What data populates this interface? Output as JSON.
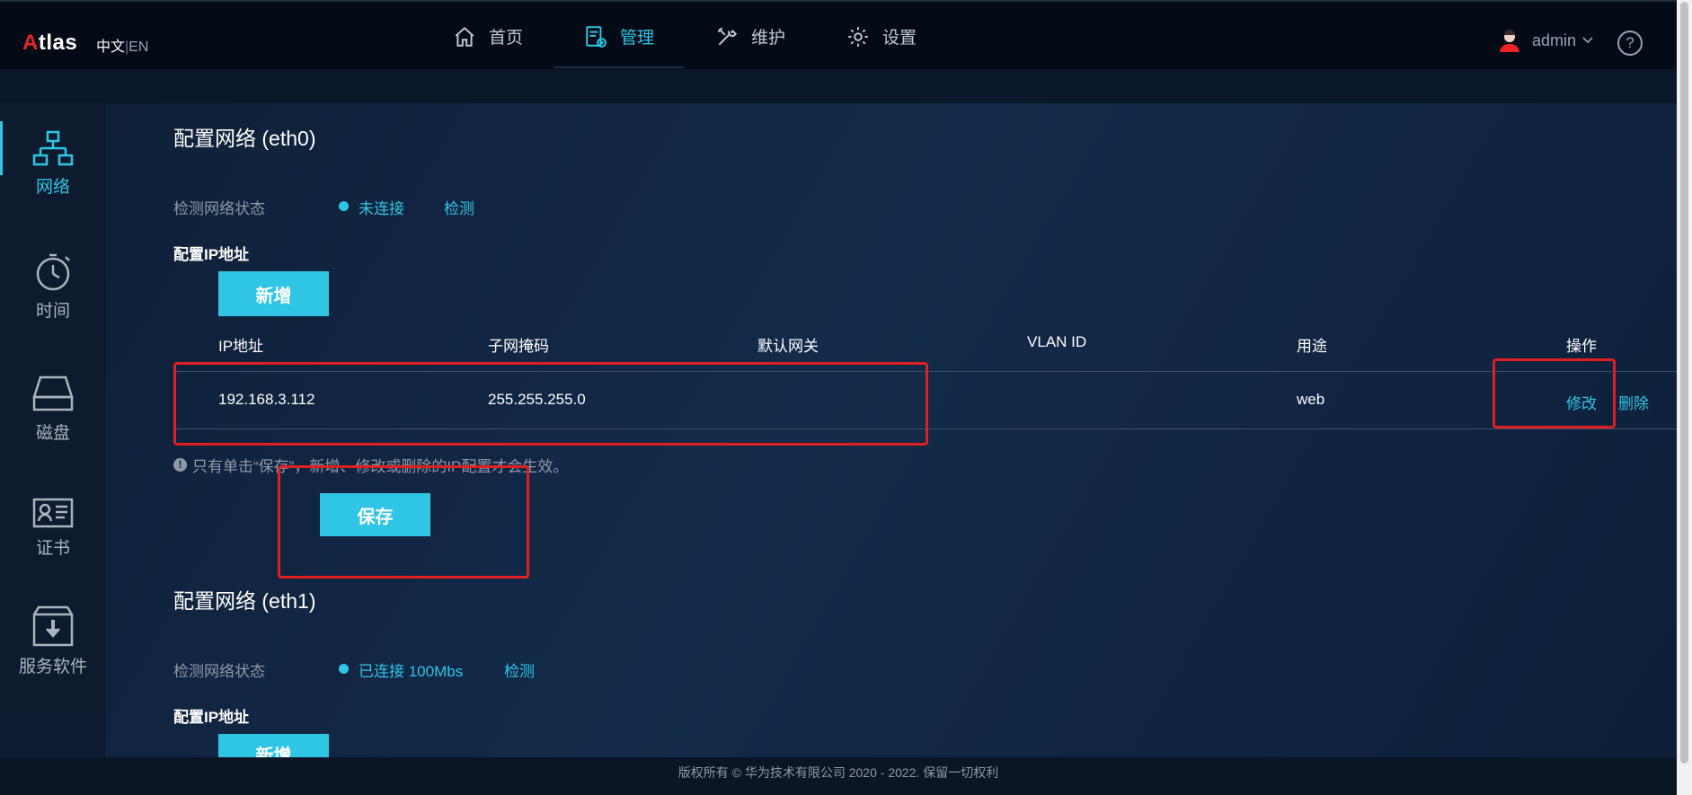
{
  "header": {
    "logo_a": "A",
    "logo_rest": "tlas",
    "lang_zh": "中文",
    "lang_sep": "|",
    "lang_en": "EN",
    "nav": [
      {
        "label": "首页",
        "icon": "home-icon"
      },
      {
        "label": "管理",
        "icon": "manage-icon"
      },
      {
        "label": "维护",
        "icon": "wrench-icon"
      },
      {
        "label": "设置",
        "icon": "gear-icon"
      }
    ],
    "active_nav": "管理",
    "user": "admin",
    "help": "?"
  },
  "sidebar": {
    "items": [
      {
        "label": "网络",
        "icon": "network-icon"
      },
      {
        "label": "时间",
        "icon": "clock-icon"
      },
      {
        "label": "磁盘",
        "icon": "disk-icon"
      },
      {
        "label": "证书",
        "icon": "certificate-icon"
      },
      {
        "label": "服务软件",
        "icon": "download-box-icon"
      }
    ],
    "active": "网络"
  },
  "eth0": {
    "title": "配置网络 (eth0)",
    "status_label": "检测网络状态",
    "status_value": "未连接",
    "detect": "检测",
    "ip_section": "配置IP地址",
    "add_button": "新增",
    "columns": [
      "IP地址",
      "子网掩码",
      "默认网关",
      "VLAN ID",
      "用途",
      "操作"
    ],
    "rows": [
      {
        "ip": "192.168.3.112",
        "mask": "255.255.255.0",
        "gateway": "",
        "vlan": "",
        "usage": "web",
        "edit": "修改",
        "delete": "删除"
      }
    ],
    "note": "只有单击“保存”，新增、修改或删除的IP配置才会生效。",
    "save_button": "保存"
  },
  "eth1": {
    "title": "配置网络 (eth1)",
    "status_label": "检测网络状态",
    "status_value": "已连接 100Mbs",
    "detect": "检测",
    "ip_section": "配置IP地址",
    "add_button": "新增"
  },
  "footer": {
    "text": "版权所有 © 华为技术有限公司 2020 - 2022. 保留一切权利"
  },
  "colors": {
    "accent": "#2fc6e6",
    "highlight_box": "#e02020",
    "logo_red": "#e42626"
  }
}
